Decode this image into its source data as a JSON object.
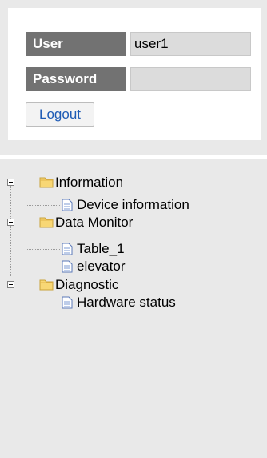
{
  "login": {
    "user_label": "User",
    "user_value": "user1",
    "password_label": "Password",
    "password_value": "",
    "logout_label": "Logout"
  },
  "tree": {
    "groups": [
      {
        "label": "Information",
        "expanded": true,
        "children": [
          {
            "label": "Device information"
          }
        ]
      },
      {
        "label": "Data Monitor",
        "expanded": true,
        "children": [
          {
            "label": "Table_1"
          },
          {
            "label": "elevator"
          }
        ]
      },
      {
        "label": "Diagnostic",
        "expanded": true,
        "children": [
          {
            "label": "Hardware status"
          }
        ]
      }
    ]
  },
  "colors": {
    "page_bg": "#e9e9e9",
    "label_bg": "#727272",
    "input_bg": "#dcdcdc",
    "link_blue": "#1e5bb5",
    "folder_yellow": "#f8d775"
  },
  "icons": {
    "folder": "folder-icon",
    "page": "page-icon",
    "toggle": "collapse-toggle-icon"
  }
}
